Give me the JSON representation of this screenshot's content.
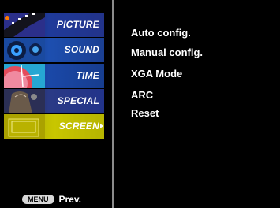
{
  "sidebar": {
    "items": [
      {
        "label": "PICTURE",
        "icon": "picture-icon"
      },
      {
        "label": "SOUND",
        "icon": "sound-icon"
      },
      {
        "label": "TIME",
        "icon": "time-icon"
      },
      {
        "label": "SPECIAL",
        "icon": "special-icon"
      },
      {
        "label": "SCREEN",
        "icon": "screen-icon",
        "selected": true
      }
    ]
  },
  "footer": {
    "menu_button": "MENU",
    "prev_label": "Prev."
  },
  "screen_menu": {
    "options": [
      "Auto config.",
      "Manual config.",
      "XGA Mode",
      "ARC",
      "Reset"
    ]
  },
  "colors": {
    "background": "#000000",
    "selected_item": "#c8c600",
    "text": "#ffffff"
  }
}
